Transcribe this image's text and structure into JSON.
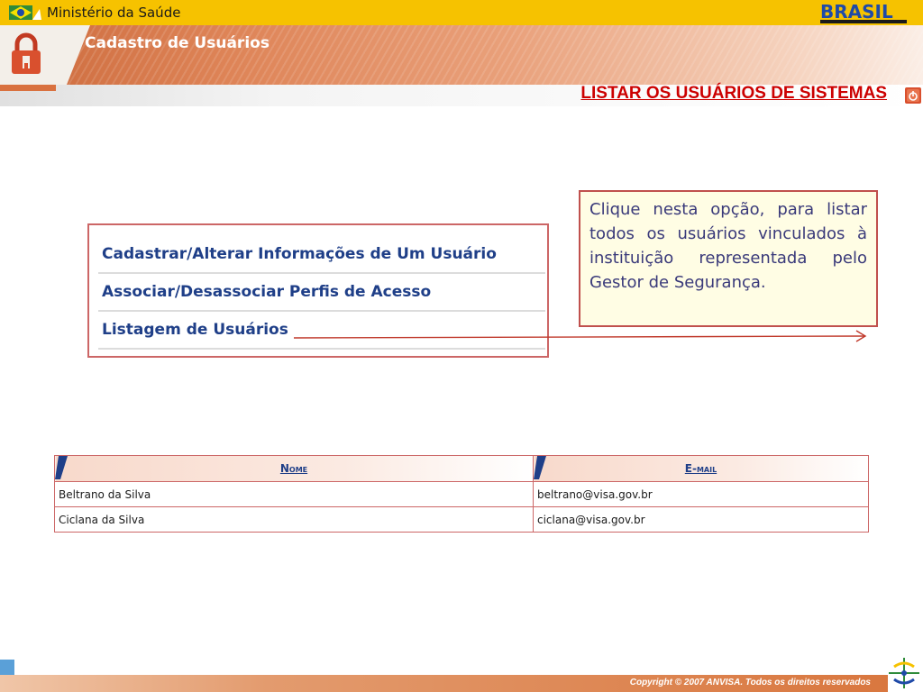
{
  "header": {
    "ministry": "Ministério da Saúde",
    "brand": "BRASIL",
    "section_title": "Cadastro de Usuários",
    "page_title": "LISTAR OS USUÁRIOS DE SISTEMAS"
  },
  "menu": {
    "items": [
      {
        "label": "Cadastrar/Alterar Informações de Um Usuário"
      },
      {
        "label": "Associar/Desassociar Perfis de Acesso"
      },
      {
        "label": "Listagem de Usuários"
      }
    ]
  },
  "callout": {
    "text": "Clique nesta opção, para listar todos os usuários vinculados à instituição representada pelo Gestor de Segurança."
  },
  "table": {
    "headers": [
      "Nome",
      "E-mail"
    ],
    "rows": [
      {
        "name": "Beltrano da Silva",
        "email": "beltrano@visa.gov.br"
      },
      {
        "name": "Ciclana da Silva",
        "email": "ciclana@visa.gov.br"
      }
    ]
  },
  "footer": {
    "copyright": "Copyright © 2007 ANVISA. Todos os direitos reservados"
  },
  "colors": {
    "title_red": "#cc0000",
    "link_blue": "#1f3f88",
    "header_orange": "#d9773f",
    "topbar_yellow": "#f6c200"
  }
}
